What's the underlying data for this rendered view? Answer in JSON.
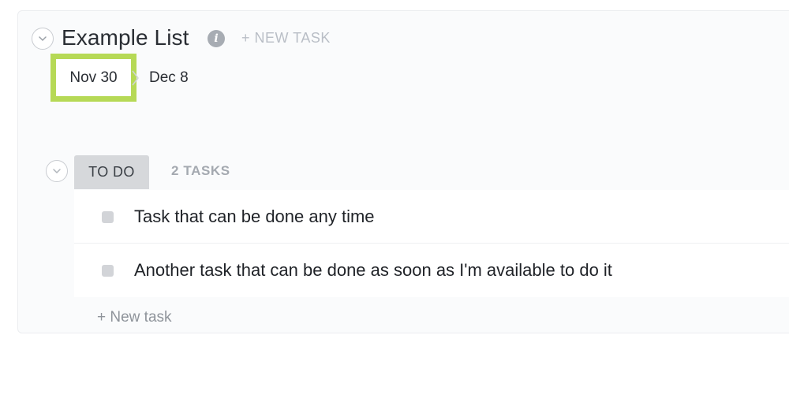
{
  "list": {
    "title": "Example List",
    "info_icon": "info-icon",
    "new_task_label": "+ NEW TASK"
  },
  "dates": {
    "start": "Nov 30",
    "end": "Dec 8"
  },
  "group": {
    "status": "TO DO",
    "count_label": "2 TASKS",
    "status_color": "#d6d8db",
    "tasks": [
      {
        "name": "Task that can be done any time"
      },
      {
        "name": "Another task that can be done as soon as I'm available to do it"
      }
    ],
    "new_task_label": "+ New task"
  },
  "colors": {
    "highlight": "#b6d956",
    "title_text": "#2a2e34",
    "muted_text": "#b9bec6"
  }
}
